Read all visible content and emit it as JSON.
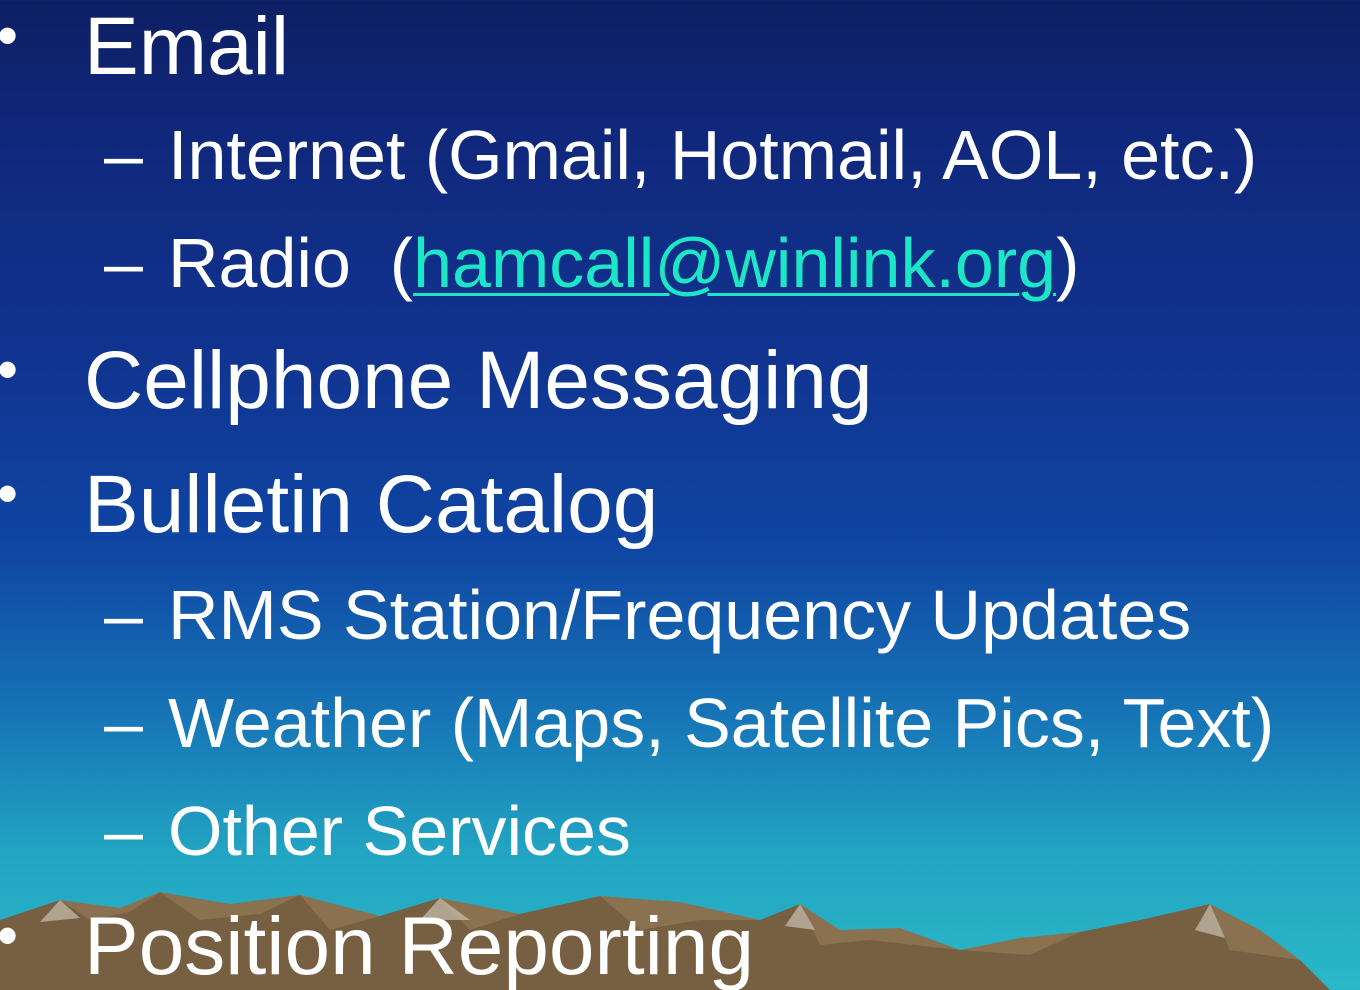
{
  "slide": {
    "bullet_glyph": "•",
    "dash_glyph": "–",
    "items": [
      {
        "level": 1,
        "text": "Email"
      },
      {
        "level": 2,
        "text": "Internet (Gmail, Hotmail, AOL, etc.)"
      },
      {
        "level": 2,
        "prefix": "Radio  (",
        "link": "hamcall@winlink.org",
        "suffix": ")"
      },
      {
        "level": 1,
        "text": "Cellphone Messaging"
      },
      {
        "level": 1,
        "text": "Bulletin Catalog"
      },
      {
        "level": 2,
        "text": "RMS Station/Frequency Updates"
      },
      {
        "level": 2,
        "text": "Weather (Maps, Satellite Pics, Text)"
      },
      {
        "level": 2,
        "text": "Other Services"
      },
      {
        "level": 1,
        "text": "Position Reporting"
      }
    ]
  },
  "colors": {
    "text": "#ffffff",
    "link": "#1de6c6",
    "background_top": "#0d1f63",
    "background_bottom": "#2ab8c8",
    "mountain": "#8a7150"
  }
}
